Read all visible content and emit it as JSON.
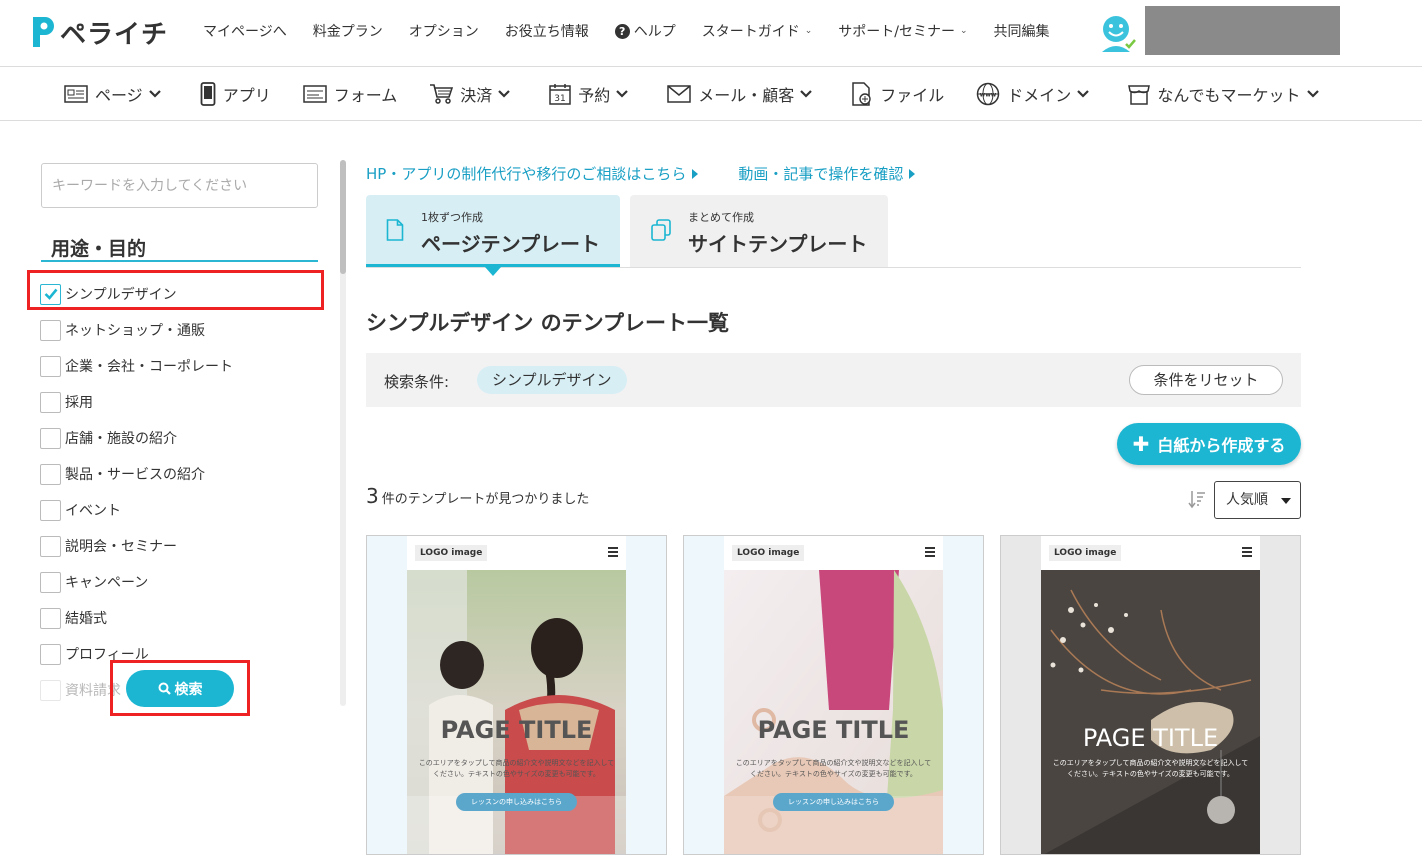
{
  "brand": {
    "name": "ペライチ",
    "accent": "#1cb6d2"
  },
  "top_nav": {
    "items": [
      {
        "label": "マイページへ",
        "dropdown": false
      },
      {
        "label": "料金プラン",
        "dropdown": false
      },
      {
        "label": "オプション",
        "dropdown": false
      },
      {
        "label": "お役立ち情報",
        "dropdown": false
      },
      {
        "label": "ヘルプ",
        "dropdown": false
      },
      {
        "label": "スタートガイド",
        "dropdown": true
      },
      {
        "label": "サポート/セミナー",
        "dropdown": true
      },
      {
        "label": "共同編集",
        "dropdown": false
      }
    ]
  },
  "sub_nav": {
    "items": [
      {
        "label": "ページ",
        "icon": "page-icon",
        "dropdown": true
      },
      {
        "label": "アプリ",
        "icon": "phone-icon",
        "dropdown": false
      },
      {
        "label": "フォーム",
        "icon": "form-icon",
        "dropdown": false
      },
      {
        "label": "決済",
        "icon": "cart-icon",
        "dropdown": true
      },
      {
        "label": "予約",
        "icon": "calendar-icon",
        "dropdown": true
      },
      {
        "label": "メール・顧客",
        "icon": "mail-icon",
        "dropdown": true
      },
      {
        "label": "ファイル",
        "icon": "file-icon",
        "dropdown": false
      },
      {
        "label": "ドメイン",
        "icon": "globe-icon",
        "dropdown": true
      },
      {
        "label": "なんでもマーケット",
        "icon": "market-icon",
        "dropdown": true
      }
    ]
  },
  "sidebar": {
    "search_placeholder": "キーワードを入力してください",
    "heading": "用途・目的",
    "categories": [
      {
        "label": "シンプルデザイン",
        "checked": true
      },
      {
        "label": "ネットショップ・通販",
        "checked": false
      },
      {
        "label": "企業・会社・コーポレート",
        "checked": false
      },
      {
        "label": "採用",
        "checked": false
      },
      {
        "label": "店舗・施設の紹介",
        "checked": false
      },
      {
        "label": "製品・サービスの紹介",
        "checked": false
      },
      {
        "label": "イベント",
        "checked": false
      },
      {
        "label": "説明会・セミナー",
        "checked": false
      },
      {
        "label": "キャンペーン",
        "checked": false
      },
      {
        "label": "結婚式",
        "checked": false
      },
      {
        "label": "プロフィール",
        "checked": false
      },
      {
        "label": "資料請求",
        "checked": false
      }
    ],
    "search_button": "検索"
  },
  "main": {
    "links": [
      "HP・アプリの制作代行や移行のご相談はこちら",
      "動画・記事で操作を確認"
    ],
    "tabs": [
      {
        "small": "1枚ずつ作成",
        "big": "ページテンプレート",
        "active": true
      },
      {
        "small": "まとめて作成",
        "big": "サイトテンプレート",
        "active": false
      }
    ],
    "list_title": "シンプルデザイン のテンプレート一覧",
    "condition_label": "検索条件:",
    "condition_chip": "シンプルデザイン",
    "reset_button": "条件をリセット",
    "create_button": "白紙から作成する",
    "result_count": "3",
    "result_suffix": "件のテンプレートが見つかりました",
    "sort_value": "人気順",
    "cards": [
      {
        "logo": "LOGO image",
        "title": "PAGE TITLE",
        "desc": "このエリアをタップして商品の紹介文や説明文などを記入してください。テキストの色やサイズの変更も可能です。",
        "button": "レッスンの申し込みはこちら"
      },
      {
        "logo": "LOGO image",
        "title": "PAGE TITLE",
        "desc": "このエリアをタップして商品の紹介文や説明文などを記入してください。テキストの色やサイズの変更も可能です。",
        "button": "レッスンの申し込みはこちら"
      },
      {
        "logo": "LOGO image",
        "title": "PAGE TITLE",
        "desc": "このエリアをタップして商品の紹介文や説明文などを記入してください。テキストの色やサイズの変更も可能です。",
        "button": ""
      }
    ]
  }
}
